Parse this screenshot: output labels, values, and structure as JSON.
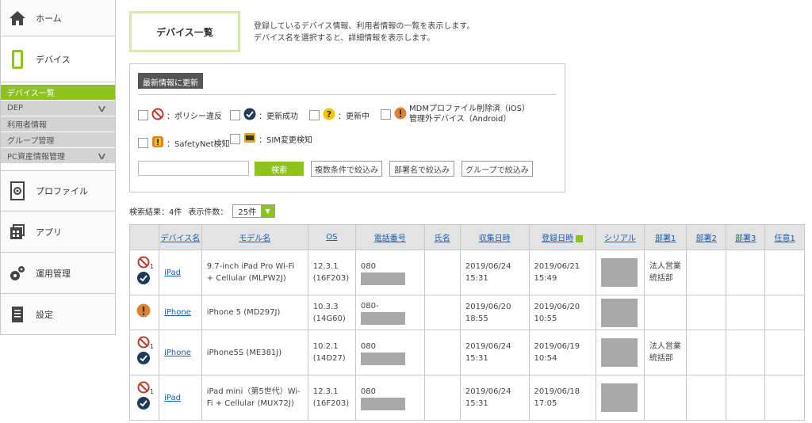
{
  "sidebar": {
    "home": "ホーム",
    "device": "デバイス",
    "sub_items": [
      {
        "label": "デバイス一覧",
        "active": true,
        "chevron": false
      },
      {
        "label": "DEP",
        "active": false,
        "chevron": true
      },
      {
        "label": "利用者情報",
        "active": false,
        "chevron": false
      },
      {
        "label": "グループ管理",
        "active": false,
        "chevron": false
      },
      {
        "label": "PC資産情報管理",
        "active": false,
        "chevron": true
      }
    ],
    "profile": "プロファイル",
    "app": "アプリ",
    "operation": "運用管理",
    "settings": "設定"
  },
  "header": {
    "title": "デバイス一覧",
    "desc_line1": "登録しているデバイス情報、利用者情報の一覧を表示します。",
    "desc_line2": "デバイス名を選択すると、詳細情報を表示します。"
  },
  "filter": {
    "refresh_label": "最新情報に更新",
    "legend": {
      "policy": "：ポリシー違反",
      "update_success": "：更新成功",
      "updating": "：更新中",
      "mdm_line1": "MDMプロファイル削除済（iOS）",
      "mdm_line2": "管理外デバイス（Android）",
      "safetynet": "：SafetyNet検知",
      "sim": "：SIM変更検知"
    },
    "search_placeholder": "",
    "search_button": "検索",
    "multi_filter": "複数条件で絞込み",
    "dept_filter": "部署名で絞込み",
    "group_filter": "グループで絞込み"
  },
  "results": {
    "count_text": "検索結果：4件",
    "per_page_label": "表示件数：",
    "per_page_value": "25件"
  },
  "table": {
    "headers": [
      "",
      "デバイス名",
      "モデル名",
      "OS",
      "電話番号",
      "氏名",
      "収集日時",
      "登録日時",
      "シリアル",
      "部署1",
      "部署2",
      "部署3",
      "任意1"
    ],
    "rows": [
      {
        "status": [
          "policy",
          "success"
        ],
        "name": "iPad",
        "model": "9.7-inch iPad Pro Wi-Fi + Cellular (MLPW2J)",
        "os": "12.3.1 (16F203)",
        "phone": "080",
        "collected": "2019/06/24 15:31",
        "registered": "2019/06/21 15:49",
        "dept1": "法人営業統括部"
      },
      {
        "status": [
          "mdm"
        ],
        "name": "iPhone",
        "model": "iPhone 5 (MD297J)",
        "os": "10.3.3 (14G60)",
        "phone": "080-",
        "collected": "2019/06/20 18:55",
        "registered": "2019/06/20 10:55",
        "dept1": ""
      },
      {
        "status": [
          "policy",
          "success"
        ],
        "name": "iPhone",
        "model": "iPhone5S (ME381J)",
        "os": "10.2.1 (14D27)",
        "phone": "080",
        "collected": "2019/06/24 15:31",
        "registered": "2019/06/19 10:54",
        "dept1": "法人営業統括部"
      },
      {
        "status": [
          "policy",
          "success"
        ],
        "name": "iPad",
        "model": "iPad mini（第5世代）Wi-Fi + Cellular (MUX72J)",
        "os": "12.3.1 (16F203)",
        "phone": "080",
        "collected": "2019/06/24 15:31",
        "registered": "2019/06/18 17:05",
        "dept1": ""
      }
    ]
  },
  "colors": {
    "accent": "#8dc21f",
    "link": "#1a5cb0"
  }
}
